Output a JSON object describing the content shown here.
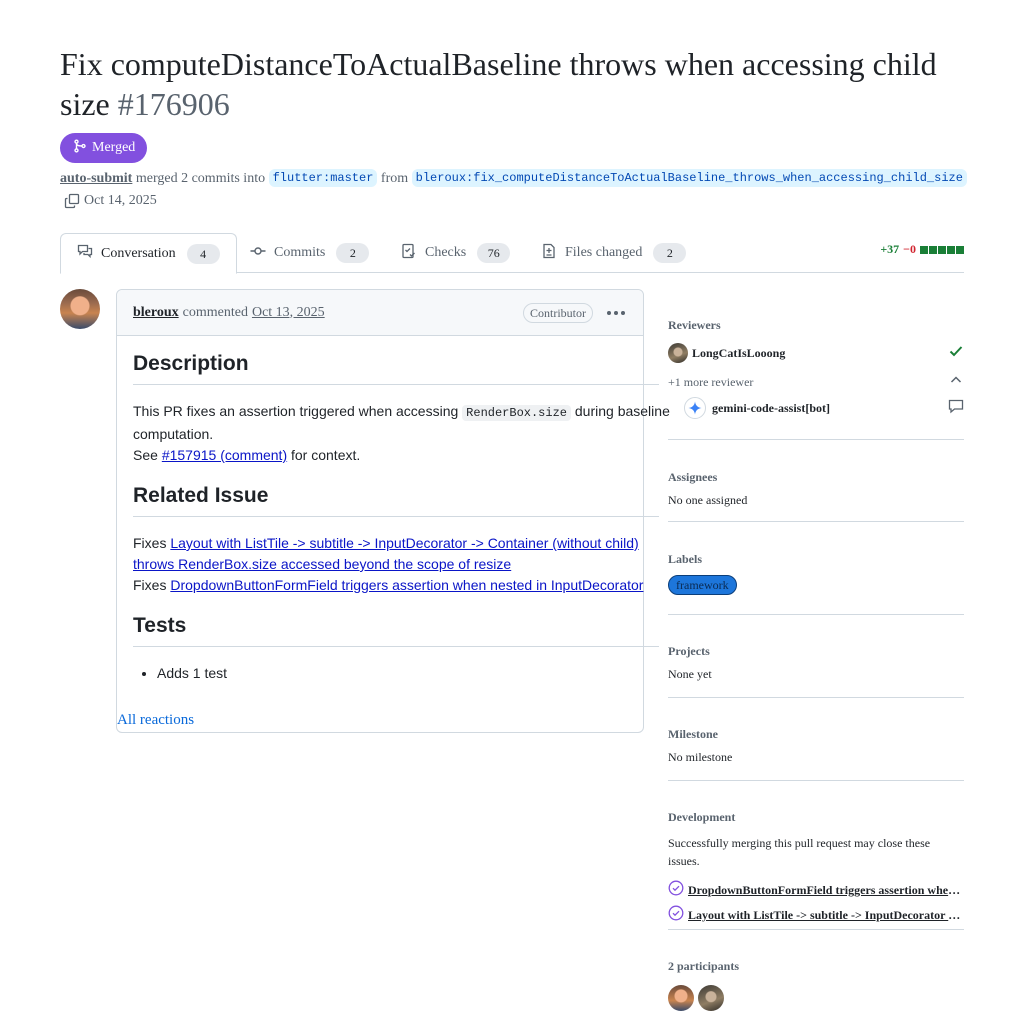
{
  "pr": {
    "title": "Fix computeDistanceToActualBaseline throws when accessing child size",
    "number": "#176906",
    "state": "Merged",
    "author": "auto-submit",
    "merge_text": "merged 2 commits into",
    "base_branch": "flutter:master",
    "from_text": "from",
    "head_branch": "bleroux:fix_computeDistanceToActualBaseline_throws_when_accessing_child_size",
    "date": "Oct 14, 2025"
  },
  "tabs": [
    {
      "label": "Conversation",
      "count": "4",
      "icon": "comment-discussion-icon"
    },
    {
      "label": "Commits",
      "count": "2",
      "icon": "git-commit-icon"
    },
    {
      "label": "Checks",
      "count": "76",
      "icon": "checklist-icon"
    },
    {
      "label": "Files changed",
      "count": "2",
      "icon": "file-diff-icon"
    }
  ],
  "diffstat": {
    "additions": "+37",
    "deletions": "−0"
  },
  "comment": {
    "author": "bleroux",
    "action": "commented",
    "date": "Oct 13, 2025",
    "role": "Contributor",
    "h_description": "Description",
    "desc_before": "This PR fixes an assertion triggered when accessing",
    "desc_code": "RenderBox.size",
    "desc_after": "during baseline computation.",
    "see_prefix": "See",
    "see_link": "#157915 (comment)",
    "see_suffix": "for context.",
    "h_related": "Related Issue",
    "fixes_word": "Fixes",
    "issue1": "Layout with ListTile -> subtitle -> InputDecorator -> Container (without child) throws RenderBox.size accessed beyond the scope of resize",
    "issue2": "DropdownButtonFormField triggers assertion when nested in InputDecorator",
    "h_tests": "Tests",
    "test_item": "Adds 1 test",
    "reactions": "All reactions"
  },
  "sidebar": {
    "reviewers_head": "Reviewers",
    "reviewer1": "LongCatIsLooong",
    "more_reviewers": "+1 more reviewer",
    "reviewer_bot": "gemini-code-assist[bot]",
    "assignees_head": "Assignees",
    "assignees_text": "No one assigned",
    "labels_head": "Labels",
    "label1": "framework",
    "projects_head": "Projects",
    "projects_text": "None yet",
    "milestone_head": "Milestone",
    "milestone_text": "No milestone",
    "development_head": "Development",
    "development_text": "Successfully merging this pull request may close these issues.",
    "dev_issue1": "DropdownButtonFormField triggers assertion when nested in InputDecorator",
    "dev_issue2": "Layout with ListTile -> subtitle -> InputDecorator -> Container (without child) throws RenderBox.size accessed beyond the scope of resize",
    "participants_head": "2 participants"
  },
  "colors": {
    "merged": "#8250df",
    "success": "#1a7f37",
    "danger": "#d1242f",
    "link": "#0969da",
    "label_framework": "#1d76db"
  }
}
